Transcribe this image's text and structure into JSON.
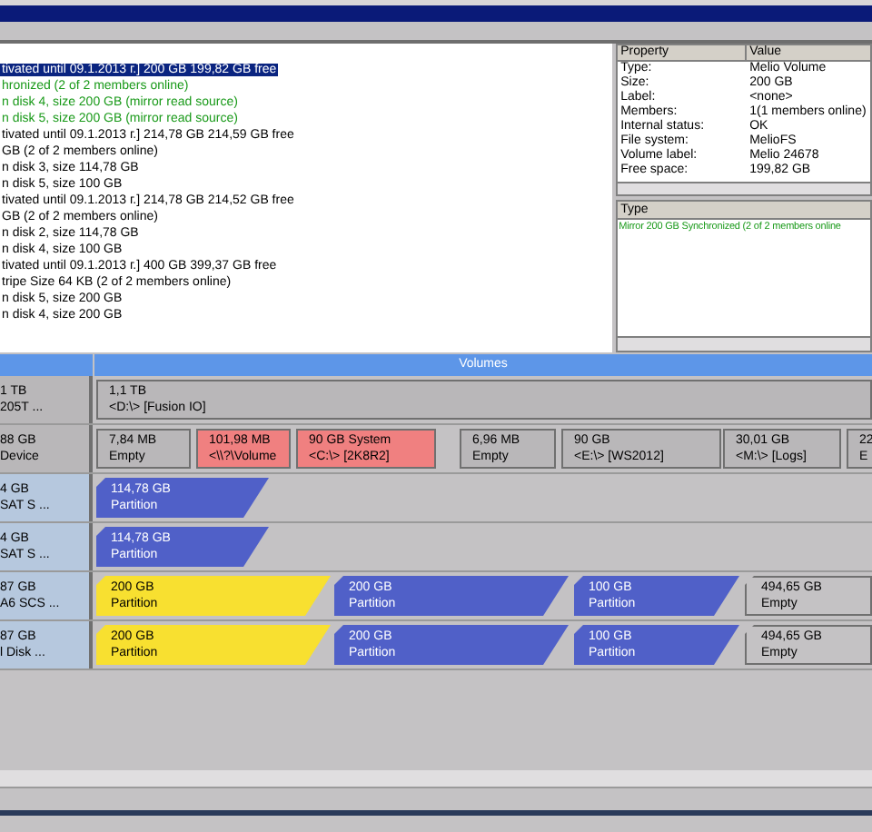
{
  "tree_lines": [
    {
      "text": "tivated until 09.1.2013 г.] 200 GB 199,82 GB free",
      "selected": true
    },
    {
      "text": "hronized  (2 of 2 members online)",
      "selected": false,
      "color": "#1a9a1a"
    },
    {
      "text": "n disk 4, size 200 GB (mirror read source)",
      "selected": false,
      "color": "#1a9a1a"
    },
    {
      "text": "n disk 5, size 200 GB (mirror read source)",
      "selected": false,
      "color": "#1a9a1a"
    },
    {
      "text": "tivated until 09.1.2013 г.] 214,78 GB 214,59 GB free",
      "selected": false,
      "color": "#000000"
    },
    {
      "text": "GB (2 of 2 members online)",
      "selected": false,
      "color": "#000000"
    },
    {
      "text": "n disk 3, size 114,78 GB",
      "selected": false,
      "color": "#000000"
    },
    {
      "text": "n disk 5, size 100 GB",
      "selected": false,
      "color": "#000000"
    },
    {
      "text": "tivated until 09.1.2013 г.] 214,78 GB 214,52 GB free",
      "selected": false,
      "color": "#000000"
    },
    {
      "text": "GB (2 of 2 members online)",
      "selected": false,
      "color": "#000000"
    },
    {
      "text": "n disk 2, size 114,78 GB",
      "selected": false,
      "color": "#000000"
    },
    {
      "text": "n disk 4, size 100 GB",
      "selected": false,
      "color": "#000000"
    },
    {
      "text": "tivated until 09.1.2013 г.] 400 GB 399,37 GB free",
      "selected": false,
      "color": "#000000"
    },
    {
      "text": "tripe Size 64 KB (2 of 2 members online)",
      "selected": false,
      "color": "#000000"
    },
    {
      "text": "n disk 5, size 200 GB",
      "selected": false,
      "color": "#000000"
    },
    {
      "text": "n disk 4, size 200 GB",
      "selected": false,
      "color": "#000000"
    }
  ],
  "properties": {
    "columns": [
      "Property",
      "Value"
    ],
    "rows": [
      [
        "Type:",
        "Melio Volume"
      ],
      [
        "Size:",
        "200 GB"
      ],
      [
        "Label:",
        "<none>"
      ],
      [
        "Members:",
        "1(1 members online)"
      ],
      [
        "Internal status:",
        "OK"
      ],
      [
        "File system:",
        "MelioFS"
      ],
      [
        "Volume label:",
        "Melio 24678"
      ],
      [
        "Free space:",
        "199,82 GB"
      ]
    ]
  },
  "type_panel": {
    "column": "Type",
    "rows": [
      {
        "text": "Mirror 200 GB Synchronized  (2 of 2 members online",
        "color": "#1a9a1a"
      }
    ]
  },
  "volumes_header": "Volumes",
  "disks": [
    {
      "line1": "1 TB",
      "line2": "205T ...",
      "kind": "device",
      "segments": [
        {
          "kind": "volume",
          "line1": "1,1 TB",
          "line2": "<D:\\> [Fusion IO]"
        }
      ]
    },
    {
      "line1": "88 GB",
      "line2": "Device",
      "kind": "device",
      "segments": [
        {
          "kind": "volume",
          "line1": "7,84 MB",
          "line2": "Empty"
        },
        {
          "kind": "system",
          "line1": "101,98 MB",
          "line2": "<\\\\?\\Volume"
        },
        {
          "kind": "system",
          "line1": "90 GB System",
          "line2": "<C:\\> [2K8R2]"
        },
        {
          "kind": "volume",
          "line1": "6,96 MB",
          "line2": "Empty"
        },
        {
          "kind": "volume",
          "line1": "90 GB",
          "line2": "<E:\\> [WS2012]"
        },
        {
          "kind": "volume",
          "line1": "30,01 GB",
          "line2": "<M:\\> [Logs]"
        },
        {
          "kind": "volume",
          "line1": "22",
          "line2": "E"
        }
      ]
    },
    {
      "line1": "4 GB",
      "line2": "SAT S ...",
      "kind": "disk",
      "segments": [
        {
          "kind": "partition",
          "line1": "114,78 GB",
          "line2": "Partition"
        }
      ]
    },
    {
      "line1": "4 GB",
      "line2": "SAT S ...",
      "kind": "disk",
      "segments": [
        {
          "kind": "partition",
          "line1": "114,78 GB",
          "line2": "Partition"
        }
      ]
    },
    {
      "line1": "87 GB",
      "line2": "A6 SCS ...",
      "kind": "disk",
      "segments": [
        {
          "kind": "mirror",
          "line1": "200 GB",
          "line2": "Partition"
        },
        {
          "kind": "partition",
          "line1": "200 GB",
          "line2": "Partition"
        },
        {
          "kind": "partition",
          "line1": "100 GB",
          "line2": "Partition"
        },
        {
          "kind": "empty",
          "line1": "494,65 GB",
          "line2": "Empty"
        }
      ]
    },
    {
      "line1": "87 GB",
      "line2": "l Disk ...",
      "kind": "disk",
      "segments": [
        {
          "kind": "mirror",
          "line1": "200 GB",
          "line2": "Partition"
        },
        {
          "kind": "partition",
          "line1": "200 GB",
          "line2": "Partition"
        },
        {
          "kind": "partition",
          "line1": "100 GB",
          "line2": "Partition"
        },
        {
          "kind": "empty",
          "line1": "494,65 GB",
          "line2": "Empty"
        }
      ]
    }
  ]
}
